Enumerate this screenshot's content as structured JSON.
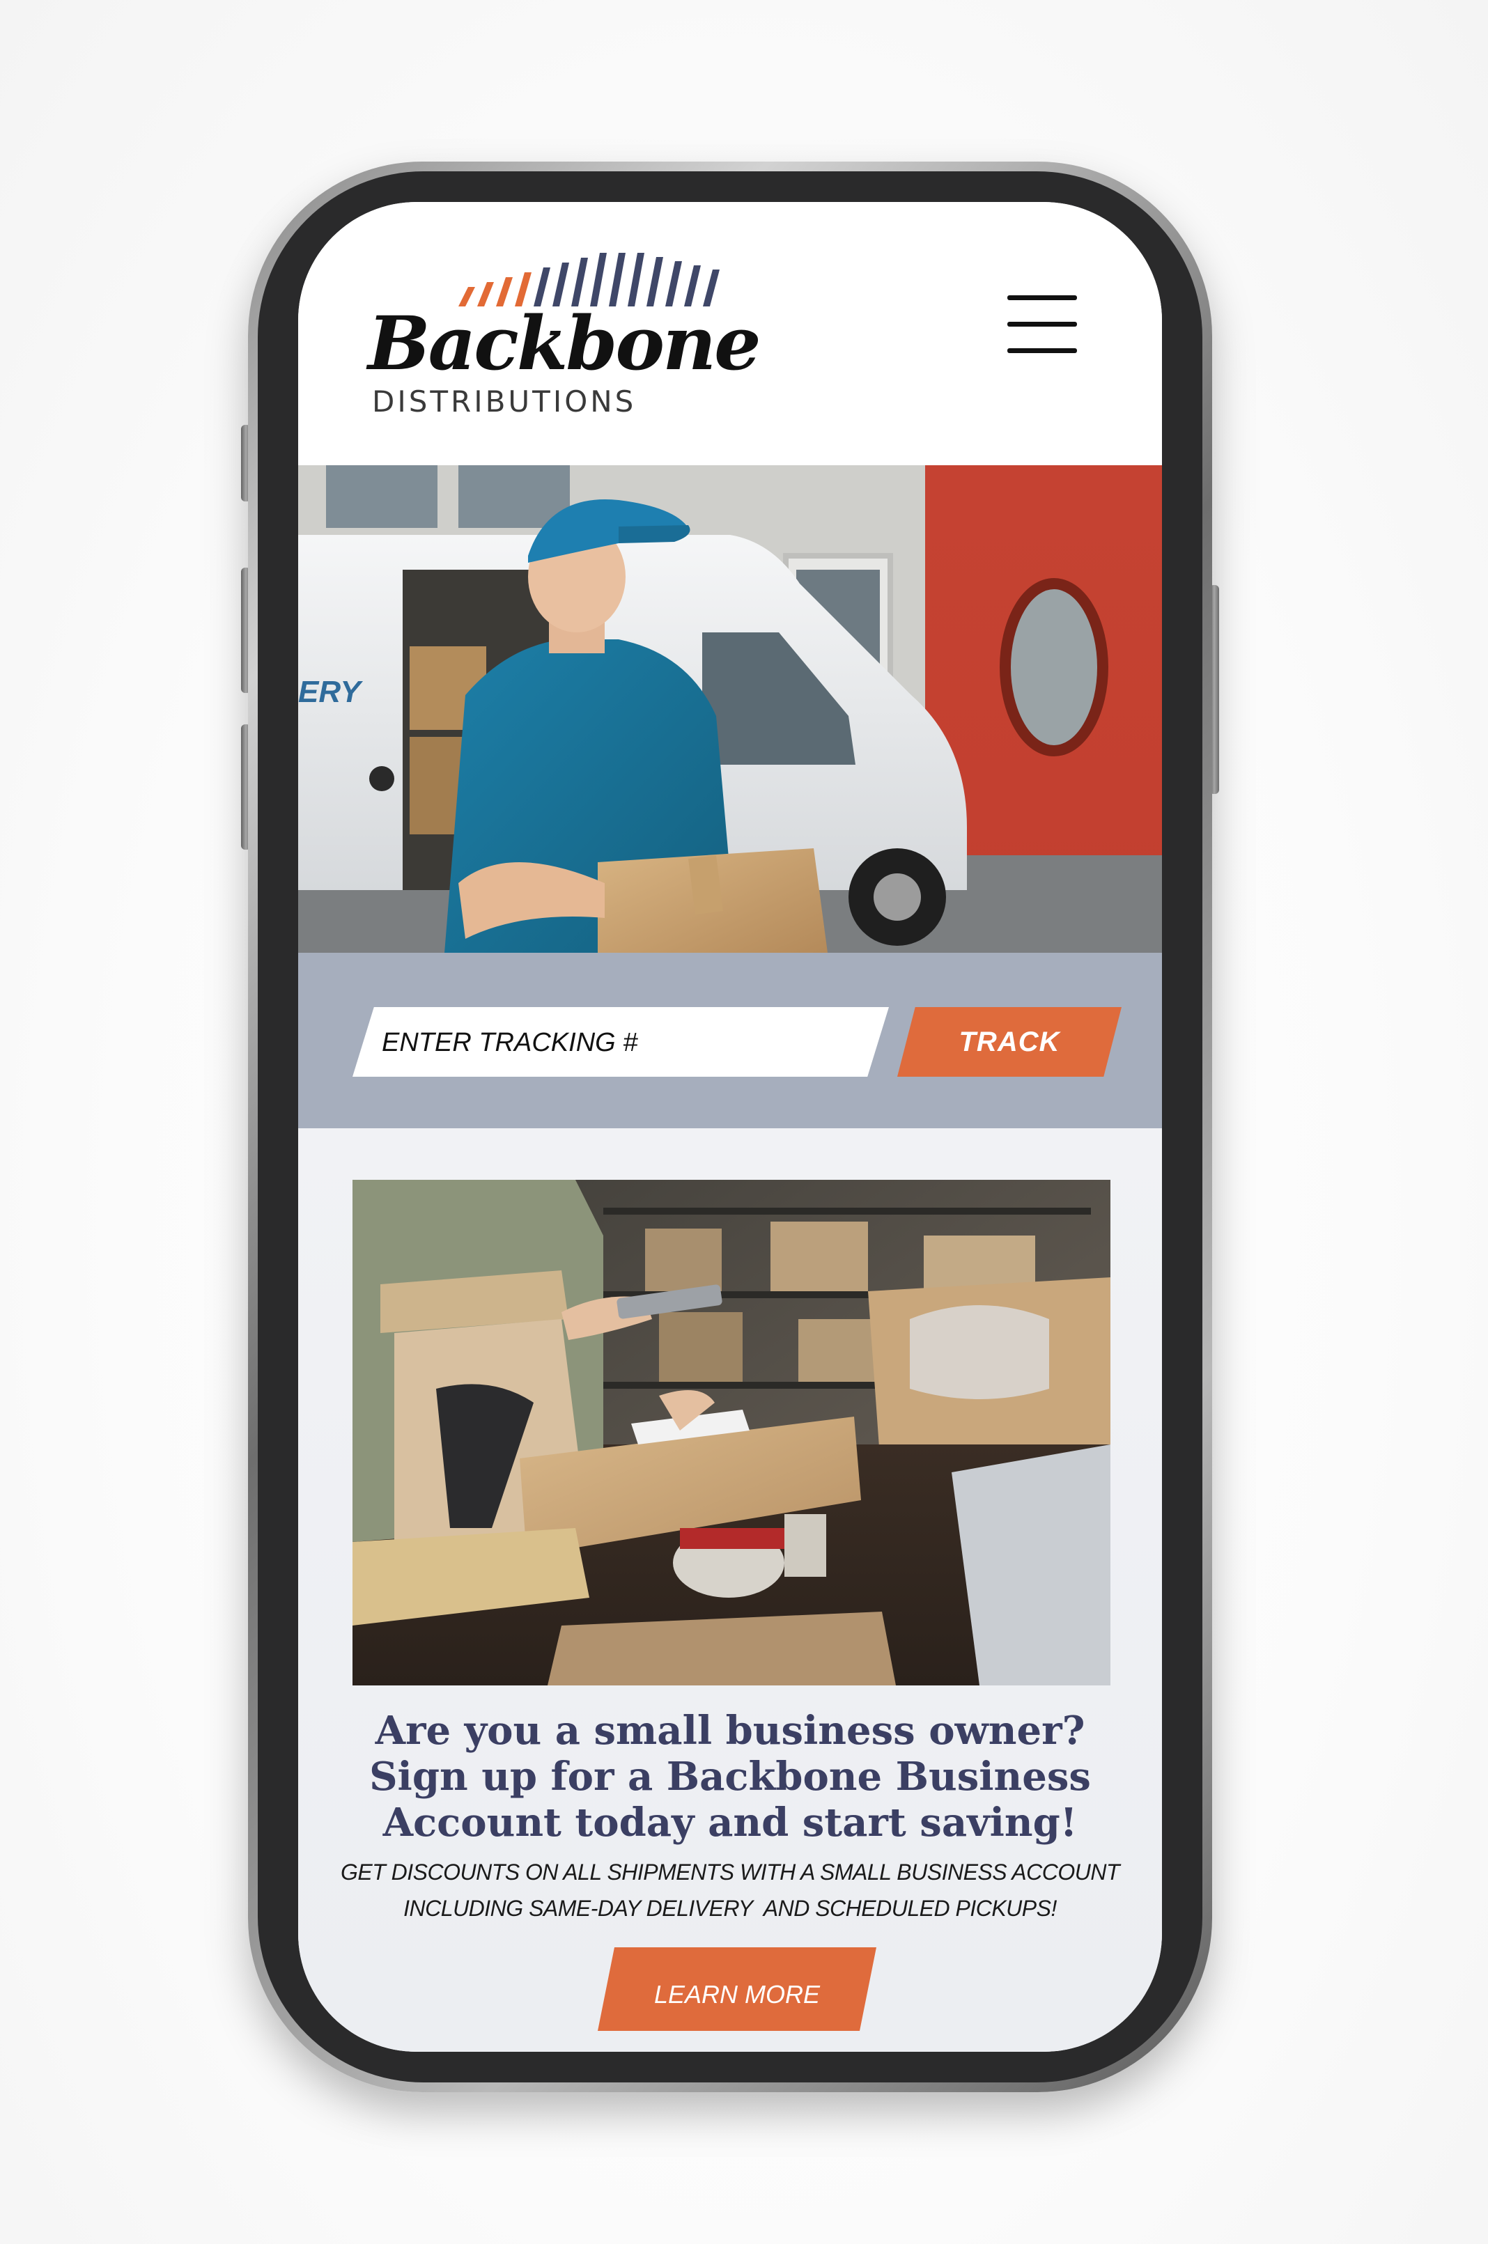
{
  "brand": {
    "name": "Backbone",
    "subtitle": "DISTRIBUTIONS",
    "bar_colors": [
      "#e26a35",
      "#3f4768"
    ]
  },
  "header": {
    "menu_icon": "hamburger-menu-icon"
  },
  "hero": {
    "van_text": "ERY"
  },
  "tracking": {
    "placeholder": "ENTER TRACKING #",
    "button_label": "TRACK"
  },
  "promo": {
    "headline_line1": "Are you a small business owner?",
    "headline_line2": "Sign up for a Backbone Business",
    "headline_line3": "Account today and start saving!",
    "body_line1": "GET DISCOUNTS ON ALL SHIPMENTS WITH A SMALL BUSINESS ACCOUNT",
    "body_line2": "INCLUDING SAME-DAY DELIVERY  AND SCHEDULED PICKUPS!",
    "button_label": "LEARN MORE"
  },
  "colors": {
    "accent": "#df6b3c",
    "navy": "#3b3f63",
    "band": "#a6aebd",
    "content_bg": "#eef0f3"
  }
}
